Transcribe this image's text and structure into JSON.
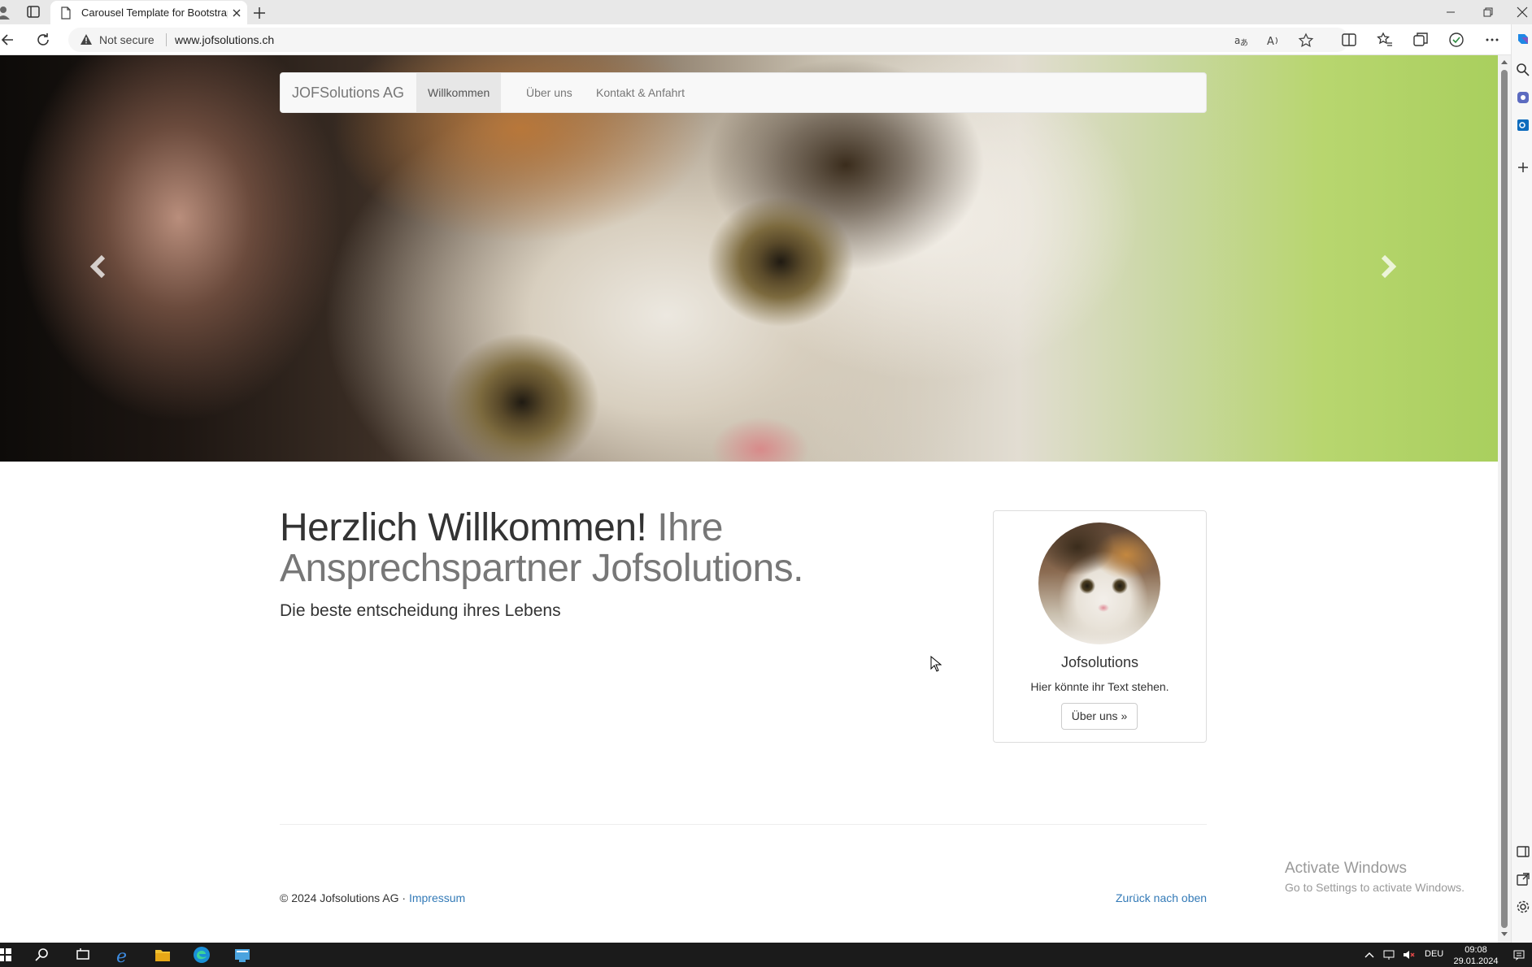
{
  "browser": {
    "tab_title": "Carousel Template for Bootstrap",
    "security_label": "Not secure",
    "url": "www.jofsolutions.ch"
  },
  "page": {
    "navbar": {
      "brand": "JOFSolutions AG",
      "links": [
        "Willkommen",
        "Über uns",
        "Kontakt & Anfahrt"
      ],
      "active_index": 0
    },
    "carousel": {
      "slide_count": 3,
      "active_slide": 1
    },
    "heading": {
      "main": "Herzlich Willkommen!",
      "muted": "Ihre Ansprechspartner Jofsolutions."
    },
    "lead": "Die beste entscheidung ihres Lebens",
    "card": {
      "name": "Jofsolutions",
      "text": "Hier könnte ihr Text stehen.",
      "button": "Über uns »"
    },
    "footer": {
      "copyright": "© 2024 Jofsolutions AG ·",
      "impressum": "Impressum",
      "back_to_top": "Zurück nach oben"
    }
  },
  "watermark": {
    "title": "Activate Windows",
    "subtitle": "Go to Settings to activate Windows."
  },
  "taskbar": {
    "language": "DEU",
    "time": "09:08",
    "date": "29.01.2024"
  },
  "colors": {
    "link": "#337ab7",
    "navbar_bg": "#f8f8f8",
    "navbar_active": "#e7e7e7",
    "taskbar_bg": "#1b1b1b"
  }
}
